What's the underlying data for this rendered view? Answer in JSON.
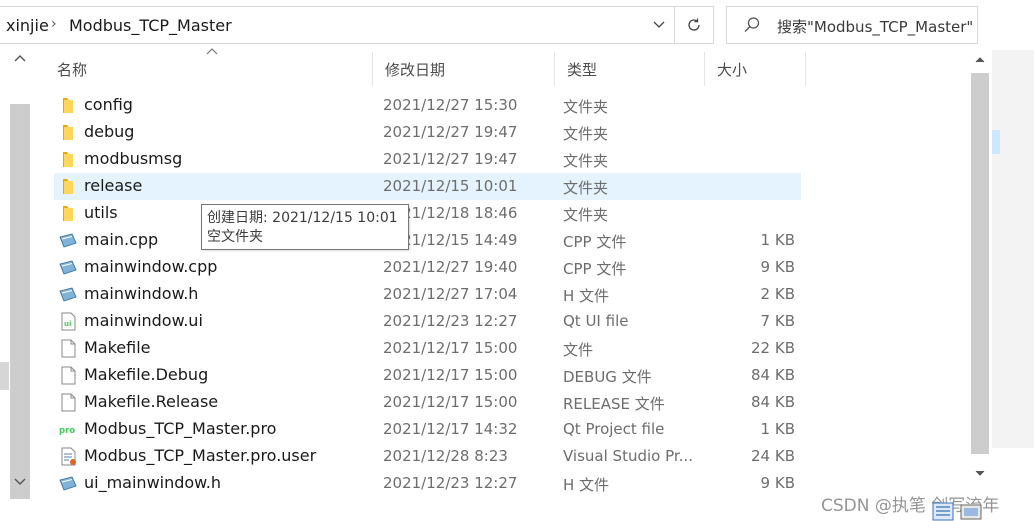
{
  "address": {
    "crumbs": [
      "xinjie",
      "Modbus_TCP_Master"
    ],
    "separator": "›"
  },
  "search": {
    "placeholder": "搜索\"Modbus_TCP_Master\""
  },
  "columns": {
    "name": "名称",
    "modified": "修改日期",
    "type": "类型",
    "size": "大小"
  },
  "files": [
    {
      "name": "config",
      "date": "2021/12/27 15:30",
      "type": "文件夹",
      "size": "",
      "icon": "folder-icon"
    },
    {
      "name": "debug",
      "date": "2021/12/27 19:47",
      "type": "文件夹",
      "size": "",
      "icon": "folder-icon"
    },
    {
      "name": "modbusmsg",
      "date": "2021/12/27 19:47",
      "type": "文件夹",
      "size": "",
      "icon": "folder-icon"
    },
    {
      "name": "release",
      "date": "2021/12/15 10:01",
      "type": "文件夹",
      "size": "",
      "icon": "folder-icon"
    },
    {
      "name": "utils",
      "date": "2021/12/18 18:46",
      "type": "文件夹",
      "size": "",
      "icon": "folder-icon"
    },
    {
      "name": "main.cpp",
      "date": "2021/12/15 14:49",
      "type": "CPP 文件",
      "size": "1 KB",
      "icon": "cpp-file-icon"
    },
    {
      "name": "mainwindow.cpp",
      "date": "2021/12/27 19:40",
      "type": "CPP 文件",
      "size": "9 KB",
      "icon": "cpp-file-icon"
    },
    {
      "name": "mainwindow.h",
      "date": "2021/12/27 17:04",
      "type": "H 文件",
      "size": "2 KB",
      "icon": "header-file-icon"
    },
    {
      "name": "mainwindow.ui",
      "date": "2021/12/23 12:27",
      "type": "Qt UI file",
      "size": "7 KB",
      "icon": "qt-ui-file-icon"
    },
    {
      "name": "Makefile",
      "date": "2021/12/17 15:00",
      "type": "文件",
      "size": "22 KB",
      "icon": "blank-file-icon"
    },
    {
      "name": "Makefile.Debug",
      "date": "2021/12/17 15:00",
      "type": "DEBUG 文件",
      "size": "84 KB",
      "icon": "blank-file-icon"
    },
    {
      "name": "Makefile.Release",
      "date": "2021/12/17 15:00",
      "type": "RELEASE 文件",
      "size": "84 KB",
      "icon": "blank-file-icon"
    },
    {
      "name": "Modbus_TCP_Master.pro",
      "date": "2021/12/17 14:32",
      "type": "Qt Project file",
      "size": "1 KB",
      "icon": "qt-pro-file-icon"
    },
    {
      "name": "Modbus_TCP_Master.pro.user",
      "date": "2021/12/28 8:23",
      "type": "Visual Studio Pr...",
      "size": "24 KB",
      "icon": "vs-project-file-icon"
    },
    {
      "name": "ui_mainwindow.h",
      "date": "2021/12/23 12:27",
      "type": "H 文件",
      "size": "9 KB",
      "icon": "header-file-icon"
    }
  ],
  "hovered_file": "release",
  "tooltip": {
    "line1": "创建日期: 2021/12/15 10:01",
    "line2": "空文件夹"
  },
  "watermark": "CSDN @执笔 剑写流年",
  "colors": {
    "hover_row": "#e5f3ff",
    "folder": "#f7c948",
    "text_muted": "#6d6d6d"
  }
}
